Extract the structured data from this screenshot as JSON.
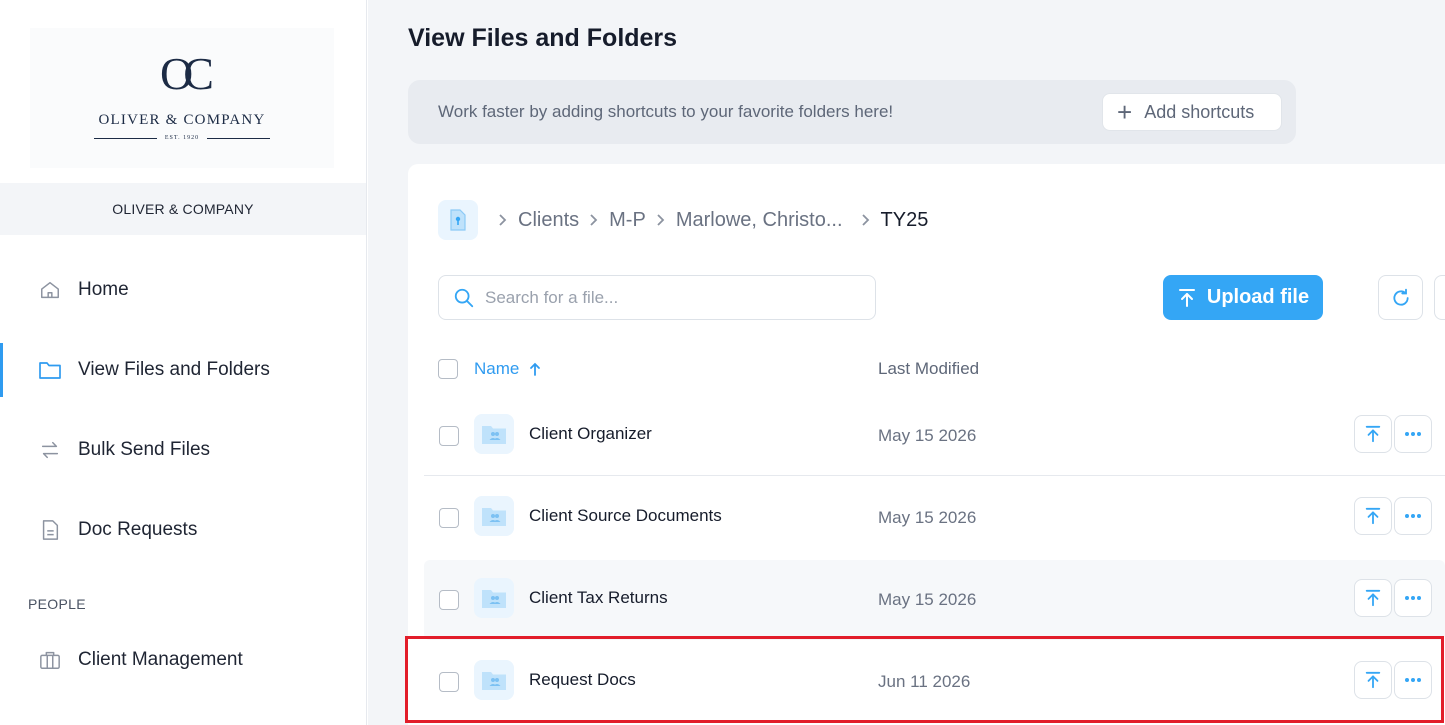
{
  "brand": {
    "monogram": "OC",
    "name": "OLIVER & COMPANY",
    "est": "EST. 1920",
    "org_label": "OLIVER & COMPANY"
  },
  "nav": {
    "items": [
      {
        "label": "Home",
        "icon": "home-icon"
      },
      {
        "label": "View Files and Folders",
        "icon": "folder-icon"
      },
      {
        "label": "Bulk Send Files",
        "icon": "swap-arrows-icon"
      },
      {
        "label": "Doc Requests",
        "icon": "document-icon"
      }
    ],
    "people_label": "PEOPLE",
    "people_items": [
      {
        "label": "Client Management",
        "icon": "briefcase-icon"
      }
    ]
  },
  "page": {
    "title": "View Files and Folders"
  },
  "shortcuts": {
    "message": "Work faster by adding shortcuts to your favorite folders here!",
    "button_label": "Add shortcuts"
  },
  "breadcrumb": {
    "items": [
      "Clients",
      "M-P",
      "Marlowe, Christo...",
      "TY25"
    ]
  },
  "search": {
    "placeholder": "Search for a file...",
    "value": ""
  },
  "toolbar": {
    "upload_label": "Upload file"
  },
  "table": {
    "columns": {
      "name": "Name",
      "modified": "Last Modified"
    },
    "sort": "ascending",
    "rows": [
      {
        "name": "Client Organizer",
        "modified": "May 15 2026"
      },
      {
        "name": "Client Source Documents",
        "modified": "May 15 2026"
      },
      {
        "name": "Client Tax Returns",
        "modified": "May 15 2026"
      },
      {
        "name": "Request Docs",
        "modified": "Jun 11 2026"
      }
    ]
  },
  "colors": {
    "accent": "#34a6f5",
    "highlight": "#e21d2a"
  }
}
